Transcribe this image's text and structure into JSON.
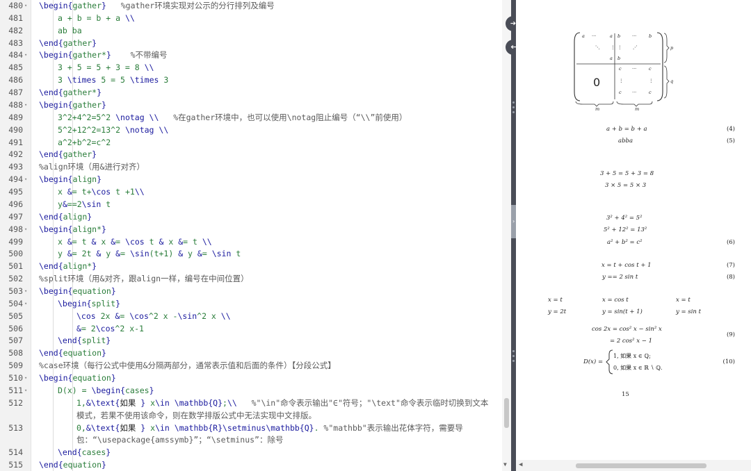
{
  "editor": {
    "lines": [
      {
        "n": "480",
        "fold": "▾",
        "indent": 1,
        "parts": [
          [
            "cmd",
            "\\begin{"
          ],
          [
            "env",
            "gather"
          ],
          [
            "cmd",
            "}"
          ],
          [
            "txt",
            "   "
          ],
          [
            "cmt",
            "%gather环境实现对公示的分行排列及编号"
          ]
        ]
      },
      {
        "n": "481",
        "fold": "",
        "indent": 2,
        "parts": [
          [
            "grn",
            "a + b = b + a "
          ],
          [
            "cmd",
            "\\\\"
          ]
        ]
      },
      {
        "n": "482",
        "fold": "",
        "indent": 2,
        "parts": [
          [
            "grn",
            "ab ba"
          ]
        ]
      },
      {
        "n": "483",
        "fold": "",
        "indent": 1,
        "parts": [
          [
            "cmd",
            "\\end{"
          ],
          [
            "env",
            "gather"
          ],
          [
            "cmd",
            "}"
          ]
        ]
      },
      {
        "n": "484",
        "fold": "▾",
        "indent": 1,
        "parts": [
          [
            "cmd",
            "\\begin{"
          ],
          [
            "env",
            "gather*"
          ],
          [
            "cmd",
            "}"
          ],
          [
            "txt",
            "    "
          ],
          [
            "cmt",
            "%不带编号"
          ]
        ]
      },
      {
        "n": "485",
        "fold": "",
        "indent": 2,
        "parts": [
          [
            "grn",
            "3 + 5 = 5 + 3 = 8 "
          ],
          [
            "cmd",
            "\\\\"
          ]
        ]
      },
      {
        "n": "486",
        "fold": "",
        "indent": 2,
        "parts": [
          [
            "grn",
            "3 "
          ],
          [
            "cmd",
            "\\times"
          ],
          [
            "grn",
            " 5 = 5 "
          ],
          [
            "cmd",
            "\\times"
          ],
          [
            "grn",
            " 3"
          ]
        ]
      },
      {
        "n": "487",
        "fold": "",
        "indent": 1,
        "parts": [
          [
            "cmd",
            "\\end{"
          ],
          [
            "env",
            "gather*"
          ],
          [
            "cmd",
            "}"
          ]
        ]
      },
      {
        "n": "488",
        "fold": "▾",
        "indent": 1,
        "parts": [
          [
            "cmd",
            "\\begin{"
          ],
          [
            "env",
            "gather"
          ],
          [
            "cmd",
            "}"
          ]
        ]
      },
      {
        "n": "489",
        "fold": "",
        "indent": 2,
        "parts": [
          [
            "grn",
            "3^2+4^2=5^2 "
          ],
          [
            "cmd",
            "\\notag \\\\"
          ],
          [
            "txt",
            "   "
          ],
          [
            "cmt",
            "%在gather环境中，也可以使用\\notag阻止编号（“\\\\”前使用）"
          ]
        ]
      },
      {
        "n": "490",
        "fold": "",
        "indent": 2,
        "parts": [
          [
            "grn",
            "5^2+12^2=13^2 "
          ],
          [
            "cmd",
            "\\notag \\\\"
          ]
        ]
      },
      {
        "n": "491",
        "fold": "",
        "indent": 2,
        "parts": [
          [
            "grn",
            "a^2+b^2=c^2"
          ]
        ]
      },
      {
        "n": "492",
        "fold": "",
        "indent": 1,
        "parts": [
          [
            "cmd",
            "\\end{"
          ],
          [
            "env",
            "gather"
          ],
          [
            "cmd",
            "}"
          ]
        ]
      },
      {
        "n": "493",
        "fold": "",
        "indent": 1,
        "parts": [
          [
            "cmt",
            "%align环境（用&进行对齐）"
          ]
        ]
      },
      {
        "n": "494",
        "fold": "▾",
        "indent": 1,
        "parts": [
          [
            "cmd",
            "\\begin{"
          ],
          [
            "env",
            "align"
          ],
          [
            "cmd",
            "}"
          ]
        ]
      },
      {
        "n": "495",
        "fold": "",
        "indent": 2,
        "parts": [
          [
            "grn",
            "x "
          ],
          [
            "sym",
            "&"
          ],
          [
            "grn",
            "= t+"
          ],
          [
            "cmd",
            "\\cos"
          ],
          [
            "grn",
            " t +1"
          ],
          [
            "cmd",
            "\\\\"
          ]
        ]
      },
      {
        "n": "496",
        "fold": "",
        "indent": 2,
        "parts": [
          [
            "grn",
            "y"
          ],
          [
            "sym",
            "&"
          ],
          [
            "grn",
            "==2"
          ],
          [
            "cmd",
            "\\sin"
          ],
          [
            "grn",
            " t"
          ]
        ]
      },
      {
        "n": "497",
        "fold": "",
        "indent": 1,
        "parts": [
          [
            "cmd",
            "\\end{"
          ],
          [
            "env",
            "align"
          ],
          [
            "cmd",
            "}"
          ]
        ]
      },
      {
        "n": "498",
        "fold": "▾",
        "indent": 1,
        "parts": [
          [
            "cmd",
            "\\begin{"
          ],
          [
            "env",
            "align*"
          ],
          [
            "cmd",
            "}"
          ]
        ]
      },
      {
        "n": "499",
        "fold": "",
        "indent": 2,
        "parts": [
          [
            "grn",
            "x "
          ],
          [
            "sym",
            "&"
          ],
          [
            "grn",
            "= t "
          ],
          [
            "sym",
            "&"
          ],
          [
            "grn",
            " x "
          ],
          [
            "sym",
            "&"
          ],
          [
            "grn",
            "= "
          ],
          [
            "cmd",
            "\\cos"
          ],
          [
            "grn",
            " t "
          ],
          [
            "sym",
            "&"
          ],
          [
            "grn",
            " x "
          ],
          [
            "sym",
            "&"
          ],
          [
            "grn",
            "= t "
          ],
          [
            "cmd",
            "\\\\"
          ]
        ]
      },
      {
        "n": "500",
        "fold": "",
        "indent": 2,
        "parts": [
          [
            "grn",
            "y "
          ],
          [
            "sym",
            "&"
          ],
          [
            "grn",
            "= 2t "
          ],
          [
            "sym",
            "&"
          ],
          [
            "grn",
            " y "
          ],
          [
            "sym",
            "&"
          ],
          [
            "grn",
            "= "
          ],
          [
            "cmd",
            "\\sin"
          ],
          [
            "grn",
            "(t+1) "
          ],
          [
            "sym",
            "&"
          ],
          [
            "grn",
            " y "
          ],
          [
            "sym",
            "&"
          ],
          [
            "grn",
            "= "
          ],
          [
            "cmd",
            "\\sin"
          ],
          [
            "grn",
            " t"
          ]
        ]
      },
      {
        "n": "501",
        "fold": "",
        "indent": 1,
        "parts": [
          [
            "cmd",
            "\\end{"
          ],
          [
            "env",
            "align*"
          ],
          [
            "cmd",
            "}"
          ]
        ]
      },
      {
        "n": "502",
        "fold": "",
        "indent": 1,
        "parts": [
          [
            "cmt",
            "%split环境（用&对齐，跟align一样，编号在中间位置）"
          ]
        ]
      },
      {
        "n": "503",
        "fold": "▾",
        "indent": 1,
        "parts": [
          [
            "cmd",
            "\\begin{"
          ],
          [
            "env",
            "equation"
          ],
          [
            "cmd",
            "}"
          ]
        ]
      },
      {
        "n": "504",
        "fold": "▾",
        "indent": 2,
        "parts": [
          [
            "cmd",
            "\\begin{"
          ],
          [
            "env",
            "split"
          ],
          [
            "cmd",
            "}"
          ]
        ]
      },
      {
        "n": "505",
        "fold": "",
        "indent": 3,
        "parts": [
          [
            "cmd",
            "\\cos"
          ],
          [
            "grn",
            " 2x "
          ],
          [
            "sym",
            "&"
          ],
          [
            "grn",
            "= "
          ],
          [
            "cmd",
            "\\cos"
          ],
          [
            "grn",
            "^2 x -"
          ],
          [
            "cmd",
            "\\sin"
          ],
          [
            "grn",
            "^2 x "
          ],
          [
            "cmd",
            "\\\\"
          ]
        ]
      },
      {
        "n": "506",
        "fold": "",
        "indent": 3,
        "parts": [
          [
            "sym",
            "&"
          ],
          [
            "grn",
            "= 2"
          ],
          [
            "cmd",
            "\\cos"
          ],
          [
            "grn",
            "^2 x-1"
          ]
        ]
      },
      {
        "n": "507",
        "fold": "",
        "indent": 2,
        "parts": [
          [
            "cmd",
            "\\end{"
          ],
          [
            "env",
            "split"
          ],
          [
            "cmd",
            "}"
          ]
        ]
      },
      {
        "n": "508",
        "fold": "",
        "indent": 1,
        "parts": [
          [
            "cmd",
            "\\end{"
          ],
          [
            "env",
            "equation"
          ],
          [
            "cmd",
            "}"
          ]
        ]
      },
      {
        "n": "509",
        "fold": "",
        "indent": 1,
        "parts": [
          [
            "cmt",
            "%case环境（每行公式中使用&分隔两部分，通常表示值和后面的条件）【分段公式】"
          ]
        ]
      },
      {
        "n": "510",
        "fold": "▾",
        "indent": 1,
        "parts": [
          [
            "cmd",
            "\\begin{"
          ],
          [
            "env",
            "equation"
          ],
          [
            "cmd",
            "}"
          ]
        ]
      },
      {
        "n": "511",
        "fold": "▾",
        "indent": 2,
        "parts": [
          [
            "grn",
            "D(x) = "
          ],
          [
            "cmd",
            "\\begin{"
          ],
          [
            "env",
            "cases"
          ],
          [
            "cmd",
            "}"
          ]
        ]
      },
      {
        "n": "512",
        "fold": "",
        "indent": 3,
        "parts": [
          [
            "grn",
            "1,"
          ],
          [
            "sym",
            "&"
          ],
          [
            "cmd",
            "\\text{"
          ],
          [
            "txt",
            "如果 "
          ],
          [
            "cmd",
            "}"
          ],
          [
            "grn",
            " x"
          ],
          [
            "cmd",
            "\\in \\mathbb{Q}"
          ],
          [
            "grn",
            ";"
          ],
          [
            "cmd",
            "\\\\"
          ],
          [
            "txt",
            "   "
          ],
          [
            "cmt",
            "%\"\\in\"命令表示输出\"∈\"符号；\"\\text\"命令表示临时切换到文本"
          ]
        ]
      },
      {
        "n": "",
        "fold": "",
        "indent": 3,
        "parts": [
          [
            "cmt",
            "模式，若果不使用该命令，则在数学排版公式中无法实现中文排版。"
          ]
        ]
      },
      {
        "n": "513",
        "fold": "",
        "indent": 3,
        "parts": [
          [
            "grn",
            "0,"
          ],
          [
            "sym",
            "&"
          ],
          [
            "cmd",
            "\\text{"
          ],
          [
            "txt",
            "如果 "
          ],
          [
            "cmd",
            "}"
          ],
          [
            "grn",
            " x"
          ],
          [
            "cmd",
            "\\in \\mathbb{R}\\setminus\\mathbb{Q}"
          ],
          [
            "grn",
            ". "
          ],
          [
            "cmt",
            "%\"mathbb\"表示输出花体字符，需要导"
          ]
        ]
      },
      {
        "n": "",
        "fold": "",
        "indent": 3,
        "parts": [
          [
            "cmt",
            "包：“\\usepackage{amssymb}”；“\\setminus”：除号"
          ]
        ]
      },
      {
        "n": "514",
        "fold": "",
        "indent": 2,
        "parts": [
          [
            "cmd",
            "\\end{"
          ],
          [
            "env",
            "cases"
          ],
          [
            "cmd",
            "}"
          ]
        ]
      },
      {
        "n": "515",
        "fold": "",
        "indent": 1,
        "parts": [
          [
            "cmd",
            "\\end{"
          ],
          [
            "env",
            "equation"
          ],
          [
            "cmd",
            "}"
          ]
        ]
      }
    ]
  },
  "divider": {
    "sync_right_icon": "➔",
    "sync_left_icon": "➔",
    "collapse_icon": "›"
  },
  "preview": {
    "matrix": {
      "a": "a",
      "b": "b",
      "dots": "···",
      "ddots": "⋱",
      "vdots": "⋮",
      "adots": "⋰",
      "c": "c",
      "zero": "0",
      "label_p": "p",
      "label_q": "q",
      "label_m1": "m",
      "label_m2": "m"
    },
    "eq_rows": [
      {
        "id": "eq-4",
        "lhs": "a + b = b + a",
        "num": "(4)"
      },
      {
        "id": "eq-5",
        "lhs": "abba",
        "num": "(5)"
      },
      {
        "id": "eq-g1",
        "lhs": "3 + 5 = 5 + 3 = 8",
        "num": ""
      },
      {
        "id": "eq-g2",
        "lhs": "3 × 5 = 5 × 3",
        "num": ""
      },
      {
        "id": "eq-p1",
        "lhs": "3² + 4² = 5²",
        "num": ""
      },
      {
        "id": "eq-p2",
        "lhs": "5² + 12² = 13²",
        "num": ""
      },
      {
        "id": "eq-6",
        "lhs": "a² + b² = c²",
        "num": "(6)"
      },
      {
        "id": "eq-7",
        "lhs": "x = t + cos t + 1",
        "num": "(7)"
      },
      {
        "id": "eq-8",
        "lhs": "y == 2 sin t",
        "num": "(8)"
      }
    ],
    "align_star": [
      [
        "x = t",
        "x = cos t",
        "x = t"
      ],
      [
        "y = 2t",
        "y = sin(t + 1)",
        "y = sin t"
      ]
    ],
    "split": {
      "line1": "cos 2x = cos² x − sin² x",
      "line2": "= 2 cos² x − 1",
      "num": "(9)"
    },
    "cases": {
      "lhs": "D(x) =",
      "row1": "1,   如果 x ∈ ℚ;",
      "row2": "0,   如果 x ∈ ℝ ∖ ℚ.",
      "num": "(10)"
    },
    "page_number": "15",
    "scroll_left_icon": "◀"
  }
}
